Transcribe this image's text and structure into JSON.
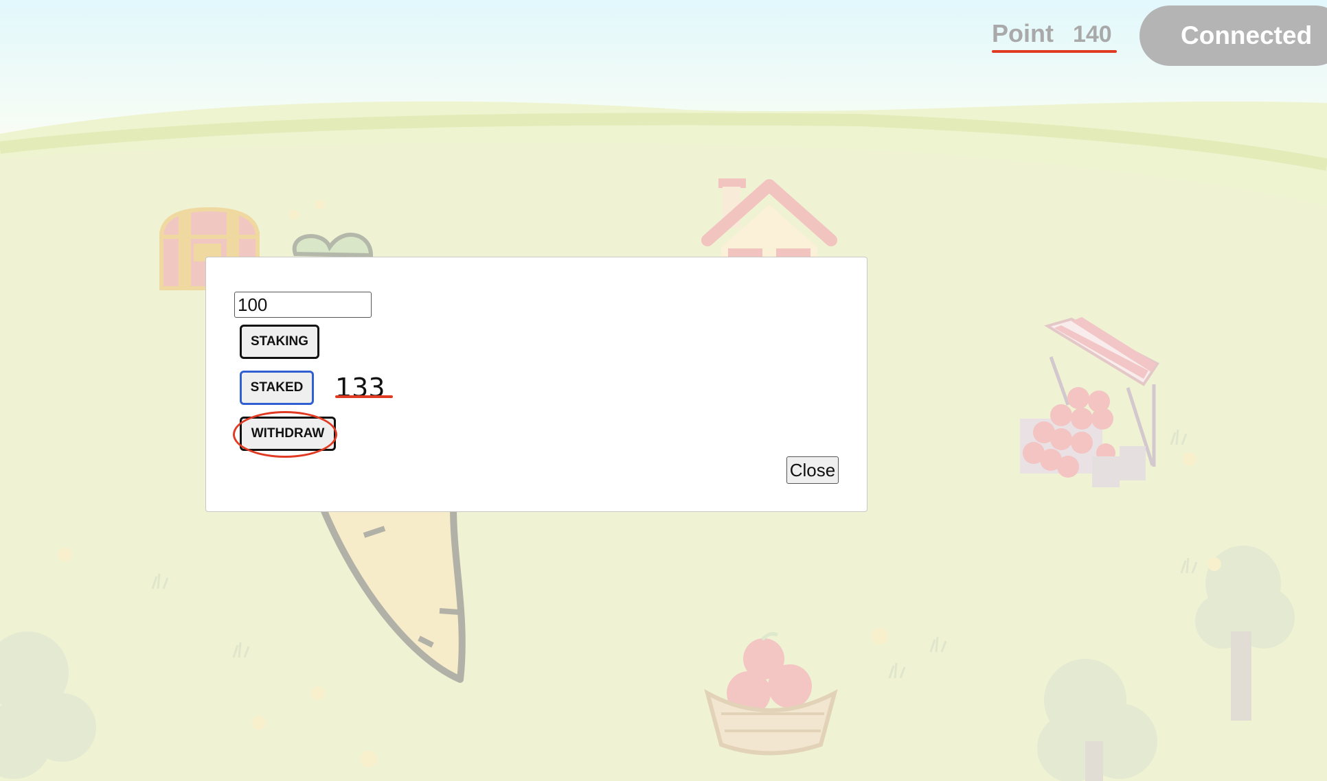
{
  "header": {
    "point_label": "Point",
    "point_value": "140",
    "connect_status": "Connected"
  },
  "modal": {
    "amount_input_value": "100",
    "staking_label": "STAKING",
    "staked_label": "STAKED",
    "staked_value": "133",
    "withdraw_label": "WITHDRAW",
    "close_label": "Close"
  },
  "colors": {
    "annotation_red": "#e03a22",
    "staked_border": "#2f5fd0",
    "connected_bg": "#b4b4b4"
  },
  "scene_icons": [
    "treasure-chest-icon",
    "carrot-icon",
    "house-icon",
    "fruit-stand-icon",
    "apple-basket-icon",
    "tree-icon",
    "flower-icon",
    "grass-tuft-icon"
  ]
}
